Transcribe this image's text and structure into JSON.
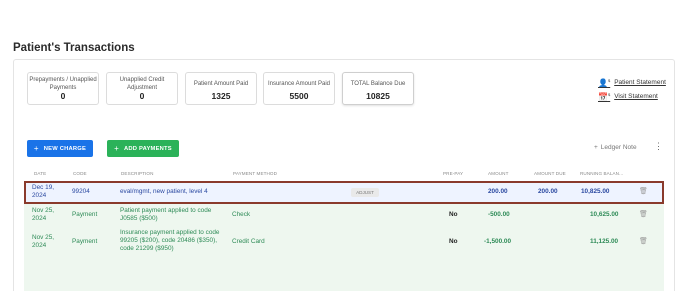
{
  "title": "Patient's Transactions",
  "summary": [
    {
      "label": "Prepayments / Unapplied Payments",
      "value": "0"
    },
    {
      "label": "Unapplied Credit Adjustment",
      "value": "0"
    },
    {
      "label": "Patient Amount Paid",
      "value": "1325"
    },
    {
      "label": "Insurance Amount Paid",
      "value": "5500"
    },
    {
      "label": "TOTAL Balance Due",
      "value": "10825"
    }
  ],
  "links": {
    "patient_statement": "Patient Statement",
    "visit_statement": "Visit Statement",
    "link_suffix": "$"
  },
  "buttons": {
    "new_charge": "NEW CHARGE",
    "add_payments": "ADD PAYMENTS",
    "ledger_note": "Ledger Note"
  },
  "columns": [
    "DATE",
    "CODE",
    "DESCRIPTION",
    "PAYMENT METHOD",
    "PRE-PAY",
    "AMOUNT",
    "AMOUNT DUE",
    "RUNNING BALAN..."
  ],
  "rows": [
    {
      "date_line1": "Dec 19,",
      "date_line2": "2024",
      "code": "99204",
      "description": [
        "eval/mgmt, new patient, level 4"
      ],
      "payment_method": "",
      "adjust_label": "ADJUST",
      "prepay": "",
      "amount": "200.00",
      "amount_due": "200.00",
      "running_balance": "10,825.00",
      "selected": true
    },
    {
      "date_line1": "Nov 25,",
      "date_line2": "2024",
      "code": "Payment",
      "description": [
        "Patient payment applied to code",
        "J0585 ($500)"
      ],
      "payment_method": "Check",
      "prepay": "No",
      "amount": "-500.00",
      "amount_due": "",
      "running_balance": "10,625.00"
    },
    {
      "date_line1": "Nov 25,",
      "date_line2": "2024",
      "code": "Payment",
      "description": [
        "Insurance payment applied to code",
        "99205 ($200), code 20486 ($350),",
        "code 21299 ($950)"
      ],
      "payment_method": "Credit Card",
      "prepay": "No",
      "amount": "-1,500.00",
      "amount_due": "",
      "running_balance": "11,125.00"
    }
  ],
  "colors": {
    "primary_blue": "#1a73e8",
    "success_green": "#2bb259",
    "highlight_border": "#8a3a2c"
  }
}
